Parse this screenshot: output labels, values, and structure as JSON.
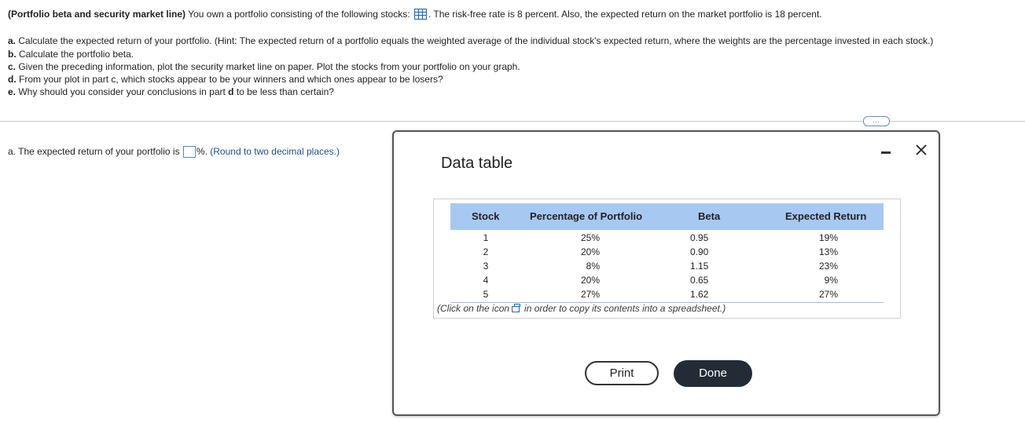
{
  "question": {
    "title_bold": "(Portfolio beta and security market line)",
    "intro_before_icon": " You own a portfolio consisting of the following stocks: ",
    "intro_after_icon": ". The risk-free rate is 8 percent. Also, the expected return on the market portfolio is 18 percent.",
    "parts": [
      {
        "label": "a.",
        "text": " Calculate the expected return of your portfolio. (Hint: The expected return of a portfolio equals the weighted average of the individual stock's expected return, where the weights are the percentage invested in each stock.)"
      },
      {
        "label": "b.",
        "text": " Calculate the portfolio beta."
      },
      {
        "label": "c.",
        "text": " Given the preceding information, plot the security market line on paper. Plot the stocks from your portfolio on your graph."
      },
      {
        "label": "d.",
        "text": " From your plot in part c, which stocks appear to be your winners and which ones appear to be losers?"
      },
      {
        "label": "e.",
        "text": " Why should you consider your conclusions in part "
      },
      {
        "label": "d",
        "text": " to be less than certain?"
      }
    ]
  },
  "more_button_label": "…",
  "answer": {
    "prefix": "a. The expected return of your portfolio is ",
    "unit": "%.",
    "hint": " (Round to two decimal places.)",
    "value": ""
  },
  "modal": {
    "title": "Data table",
    "headers": [
      "Stock",
      "Percentage of Portfolio",
      "Beta",
      "Expected Return"
    ],
    "rows": [
      {
        "stock": "1",
        "pct": "25%",
        "beta": "0.95",
        "ret": "19%"
      },
      {
        "stock": "2",
        "pct": "20%",
        "beta": "0.90",
        "ret": "13%"
      },
      {
        "stock": "3",
        "pct": "8%",
        "beta": "1.15",
        "ret": "23%"
      },
      {
        "stock": "4",
        "pct": "20%",
        "beta": "0.65",
        "ret": "9%"
      },
      {
        "stock": "5",
        "pct": "27%",
        "beta": "1.62",
        "ret": "27%"
      }
    ],
    "note_before": "(Click on the icon",
    "note_after": "in order to copy its contents into a spreadsheet.)",
    "print_label": "Print",
    "done_label": "Done"
  },
  "icons": {
    "data_table": "table-grid-icon",
    "copy": "copy-icon",
    "minimize": "minimize-icon",
    "close": "close-icon"
  }
}
